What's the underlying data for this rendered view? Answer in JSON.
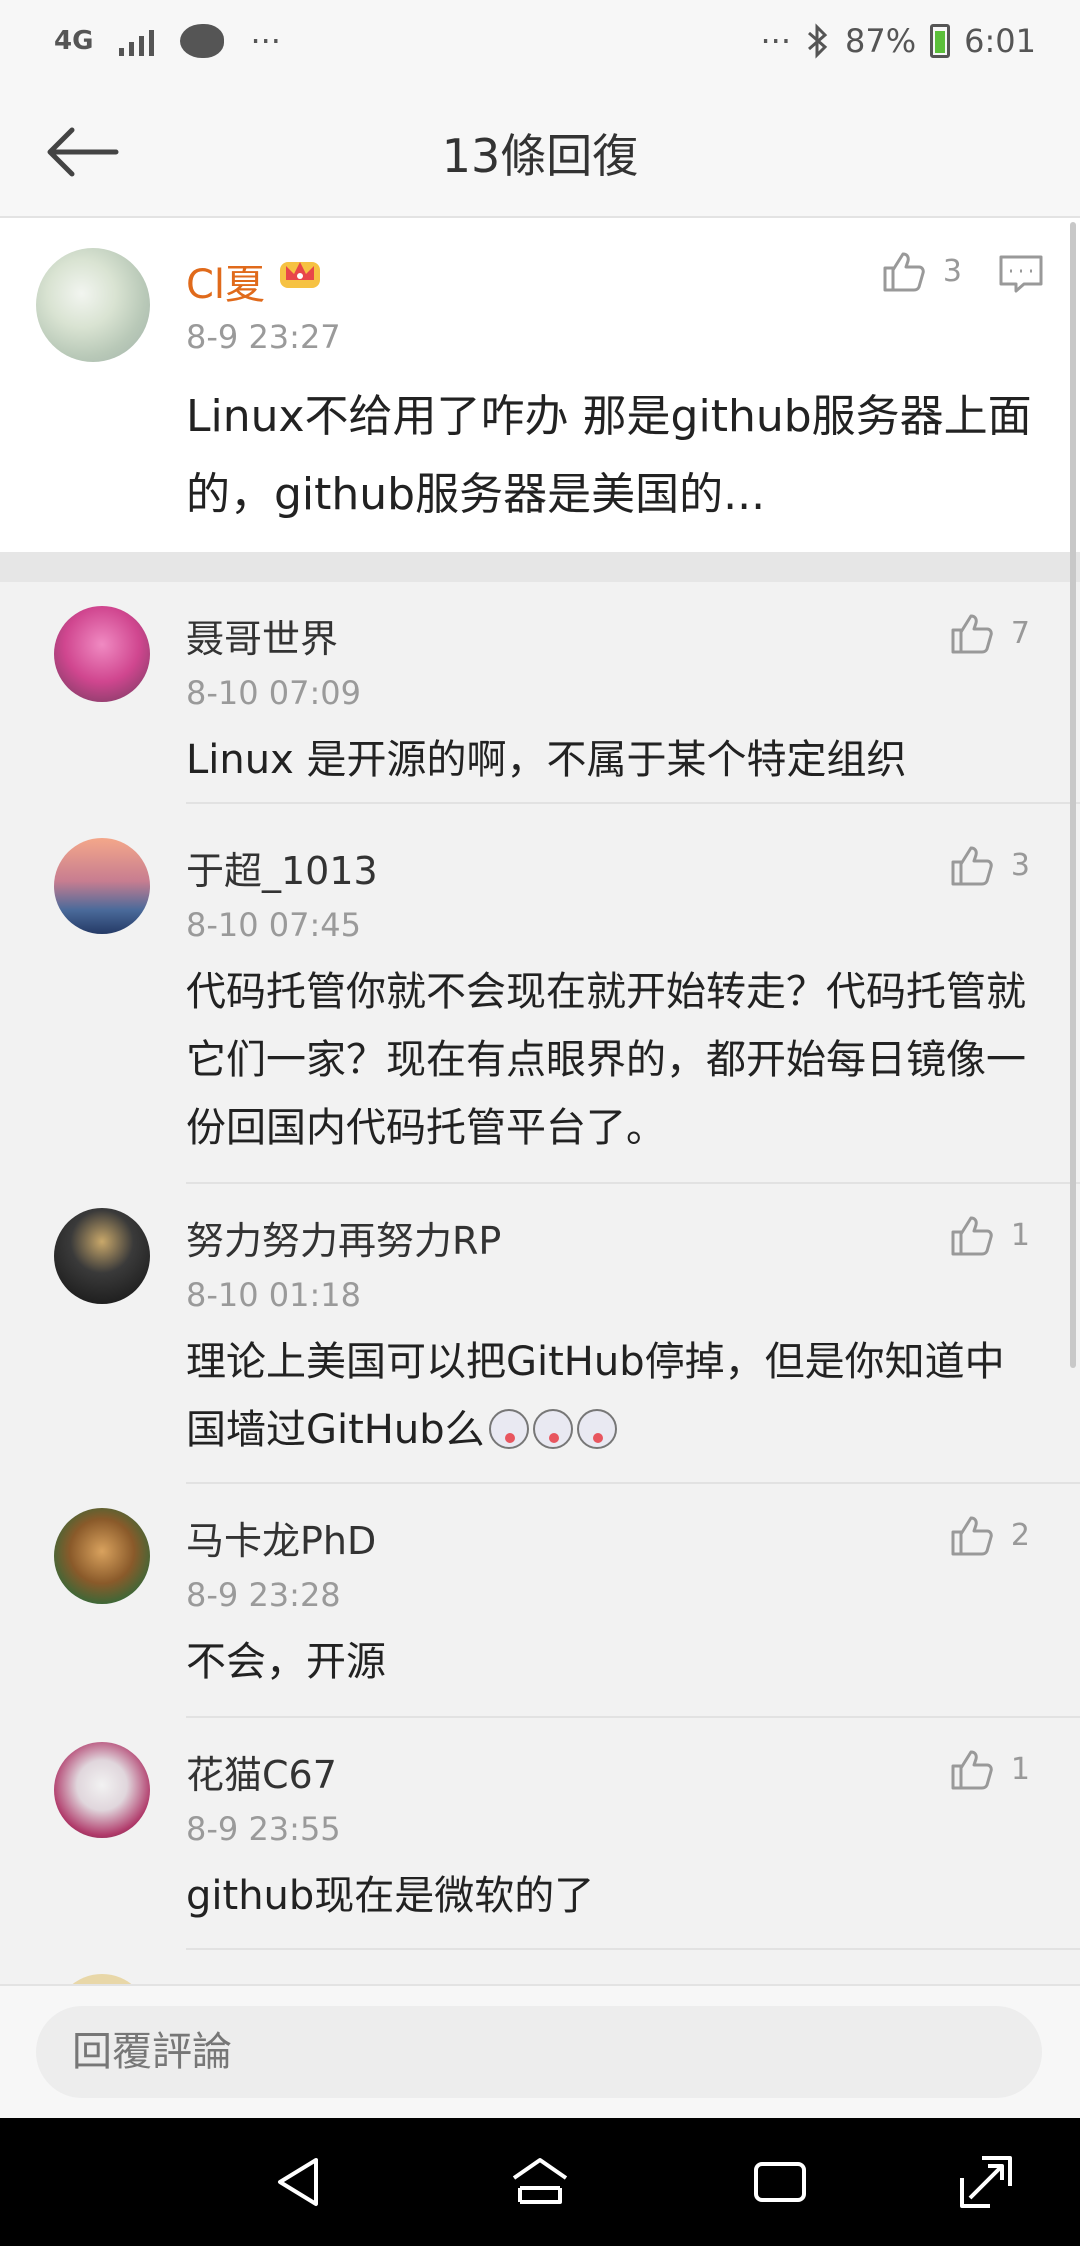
{
  "status_bar": {
    "network": "4G",
    "dots_left": "···",
    "dots_right": "···",
    "battery": "87%",
    "time": "6:01"
  },
  "header": {
    "title": "13條回復"
  },
  "main_comment": {
    "name": "Cl夏",
    "time": "8-9 23:27",
    "likes": "3",
    "text": "Linux不给用了咋办 那是github服务器上面的，github服务器是美国的..."
  },
  "replies": [
    {
      "name": "聂哥世界",
      "time": "8-10 07:09",
      "likes": "7",
      "text": "Linux 是开源的啊，不属于某个特定组织"
    },
    {
      "name": "于超_1013",
      "time": "8-10 07:45",
      "likes": "3",
      "text": "代码托管你就不会现在就开始转走？代码托管就它们一家？现在有点眼界的，都开始每日镜像一份回国内代码托管平台了。"
    },
    {
      "name": "努力努力再努力RP",
      "time": "8-10 01:18",
      "likes": "1",
      "text": "理论上美国可以把GitHub停掉，但是你知道中国墙过GitHub么"
    },
    {
      "name": "马卡龙PhD",
      "time": "8-9 23:28",
      "likes": "2",
      "text": "不会，开源"
    },
    {
      "name": "花猫C67",
      "time": "8-9 23:55",
      "likes": "1",
      "text": "github现在是微软的了"
    }
  ],
  "input": {
    "placeholder": "回覆評論"
  },
  "colors": {
    "accent_name": "#e06a1b",
    "battery": "#5bbf3a"
  }
}
